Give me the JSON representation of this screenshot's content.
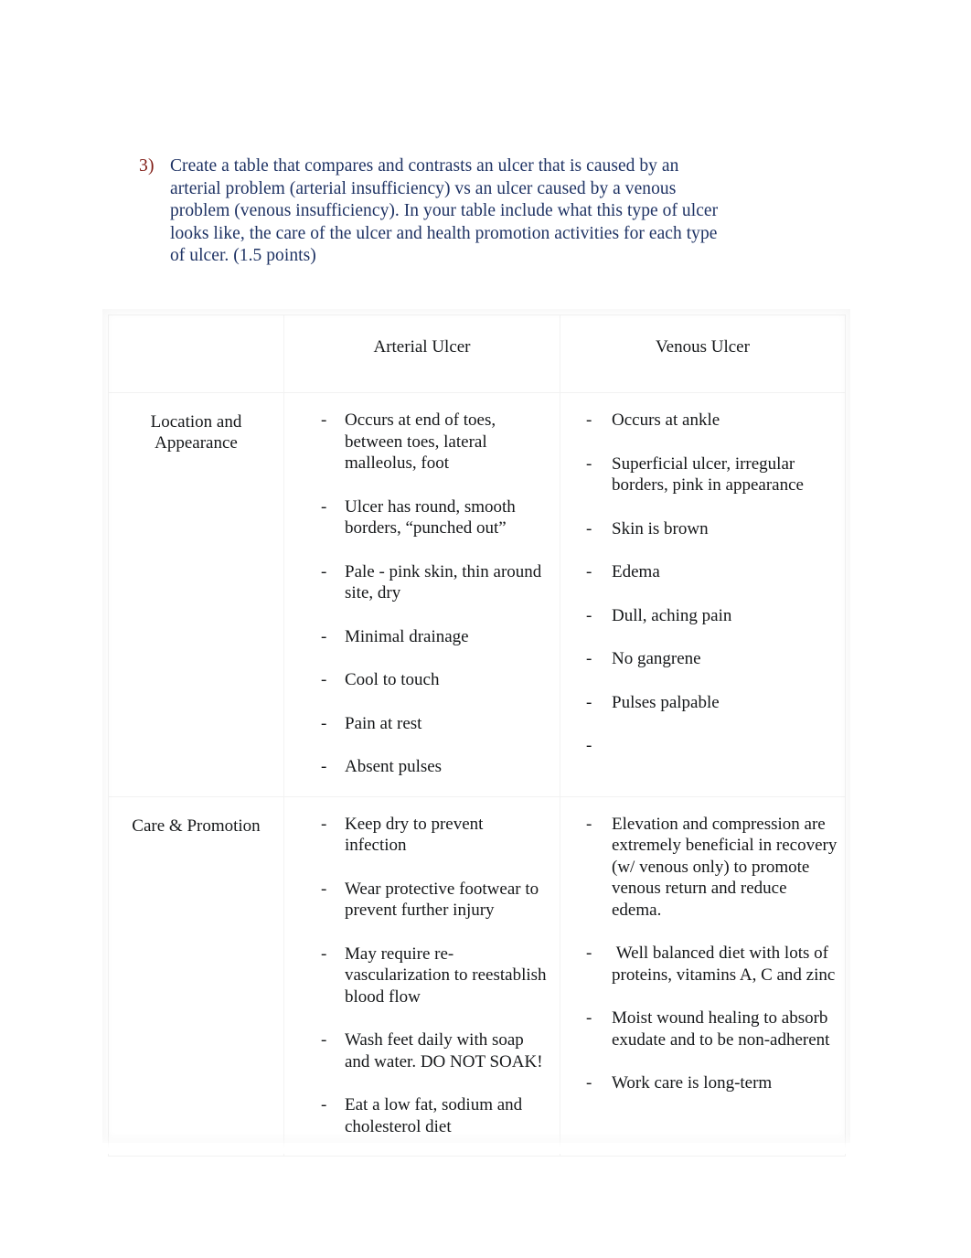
{
  "page": {
    "background_color": "#ffffff"
  },
  "question": {
    "number": "3)",
    "number_color": "#7f1b14",
    "text_color": "#1f3364",
    "text": "Create a table that compares and contrasts an ulcer that is caused by an arterial problem (arterial insufficiency) vs an ulcer caused by a venous problem (venous insufficiency). In your table include what this type of ulcer looks like, the care of the ulcer and health promotion activities for each type of ulcer. (1.5 points)"
  },
  "table": {
    "headers": {
      "corner": "",
      "arterial": "Arterial Ulcer",
      "venous": "Venous Ulcer"
    },
    "rows": [
      {
        "label": "Location and Appearance",
        "label_line1": "Location and",
        "label_line2": "Appearance",
        "arterial": [
          "Occurs at end of toes, between toes, lateral malleolus, foot",
          "Ulcer has round, smooth borders, “punched out”",
          "Pale - pink skin, thin around site, dry",
          "Minimal drainage",
          "Cool to touch",
          "Pain at rest",
          "Absent pulses"
        ],
        "venous": [
          "Occurs at ankle",
          "Superficial ulcer, irregular borders, pink in appearance",
          "Skin is brown",
          "Edema",
          "Dull, aching pain",
          "No gangrene",
          "Pulses palpable",
          ""
        ]
      },
      {
        "label": "Care & Promotion",
        "label_line1": "Care & Promotion",
        "label_line2": "",
        "arterial": [
          "Keep dry to prevent infection",
          "Wear protective footwear to prevent further injury",
          "May require re-vascularization to reestablish blood flow",
          "Wash feet daily with soap and water. DO NOT SOAK!",
          "Eat a low fat, sodium and cholesterol diet"
        ],
        "venous": [
          "Elevation and compression are extremely beneficial in recovery (w/ venous only) to promote venous return and reduce edema.",
          " Well balanced diet with lots of proteins, vitamins A, C and zinc",
          "Moist wound healing to absorb exudate and to be non-adherent",
          "Work care is long-term"
        ]
      }
    ],
    "border_color": "#f2f2f2",
    "text_color": "#16181a"
  }
}
